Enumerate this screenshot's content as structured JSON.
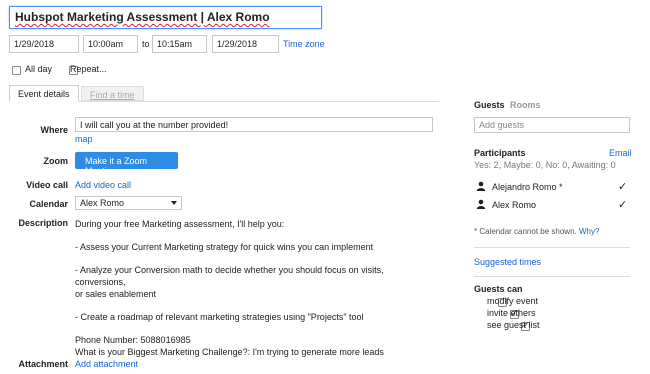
{
  "event": {
    "title": "Hubspot Marketing Assessment | Alex Romo",
    "start_date": "1/29/2018",
    "start_time": "10:00am",
    "to_label": "to",
    "end_time": "10:15am",
    "end_date": "1/29/2018",
    "time_zone_link": "Time zone",
    "all_day_label": "All day",
    "repeat_label": "Repeat..."
  },
  "tabs": [
    {
      "label": "Event details"
    },
    {
      "label": "Find a time"
    }
  ],
  "details": {
    "where_label": "Where",
    "where_value": "I will call you at the number provided!",
    "map_link": "map",
    "zoom_label": "Zoom",
    "zoom_button": "Make it a Zoom Meeting",
    "video_label": "Video call",
    "video_link": "Add video call",
    "calendar_label": "Calendar",
    "calendar_value": "Alex Romo",
    "description_label": "Description",
    "description_lines": [
      "During your free Marketing assessment, I'll help you:",
      "- Assess your Current Marketing strategy for quick wins you can implement",
      "- Analyze your Conversion math to decide whether you should focus on visits, conversions,",
      "or sales enablement",
      "- Create a roadmap of relevant marketing strategies using \"Projects\" tool",
      "Phone Number: 5088016985",
      "What is your Biggest Marketing Challenge?: I'm trying to generate more leads"
    ],
    "attachment_label": "Attachment",
    "attachment_link": "Add attachment"
  },
  "guests": {
    "tab_guests": "Guests",
    "tab_rooms": "Rooms",
    "add_placeholder": "Add guests",
    "participants_label": "Participants",
    "email_link": "Email",
    "summary": "Yes: 2, Maybe: 0, No: 0, Awaiting: 0",
    "people": [
      {
        "name": "Alejandro Romo *"
      },
      {
        "name": "Alex Romo"
      }
    ],
    "footnote": "* Calendar cannot be shown.",
    "why_link": "Why?",
    "suggested_times": "Suggested times",
    "guests_can_label": "Guests can",
    "permissions": [
      {
        "label": "modify event",
        "checked": false
      },
      {
        "label": "invite others",
        "checked": true
      },
      {
        "label": "see guest list",
        "checked": true
      }
    ]
  }
}
